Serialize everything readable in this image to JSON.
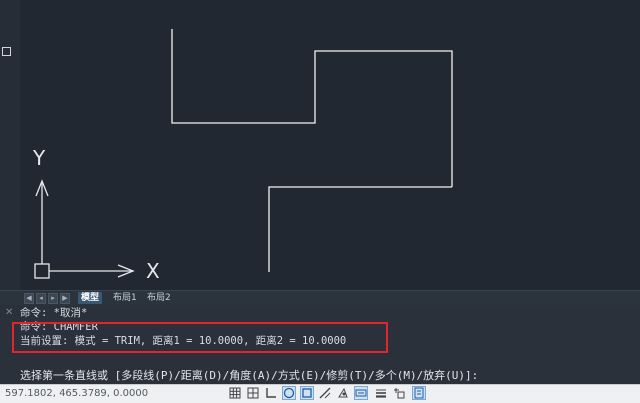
{
  "tabs": {
    "model": "模型",
    "layout1": "布局1",
    "layout2": "布局2"
  },
  "axes": {
    "y": "Y",
    "x": "X"
  },
  "command": {
    "line1": "命令: *取消*",
    "line2": "命令: CHAMFER",
    "line3": "当前设置: 模式 = TRIM, 距离1 = 10.0000, 距离2 = 10.0000",
    "prompt": "选择第一条直线或 [多段线(P)/距离(D)/角度(A)/方式(E)/修剪(T)/多个(M)/放弃(U)]:"
  },
  "status": {
    "coords": "597.1802, 465.3789, 0.0000",
    "icons": [
      "grid-icon",
      "snap-icon",
      "ortho-icon",
      "polar-icon",
      "osnap-icon",
      "otrack-icon",
      "ducs-icon",
      "dyn-icon",
      "lineweight-icon",
      "selection-cycling-icon",
      "quick-properties-icon"
    ]
  },
  "colors": {
    "canvas": "#212831",
    "highlight": "#e3242b",
    "active_tab": "#3b5873"
  }
}
